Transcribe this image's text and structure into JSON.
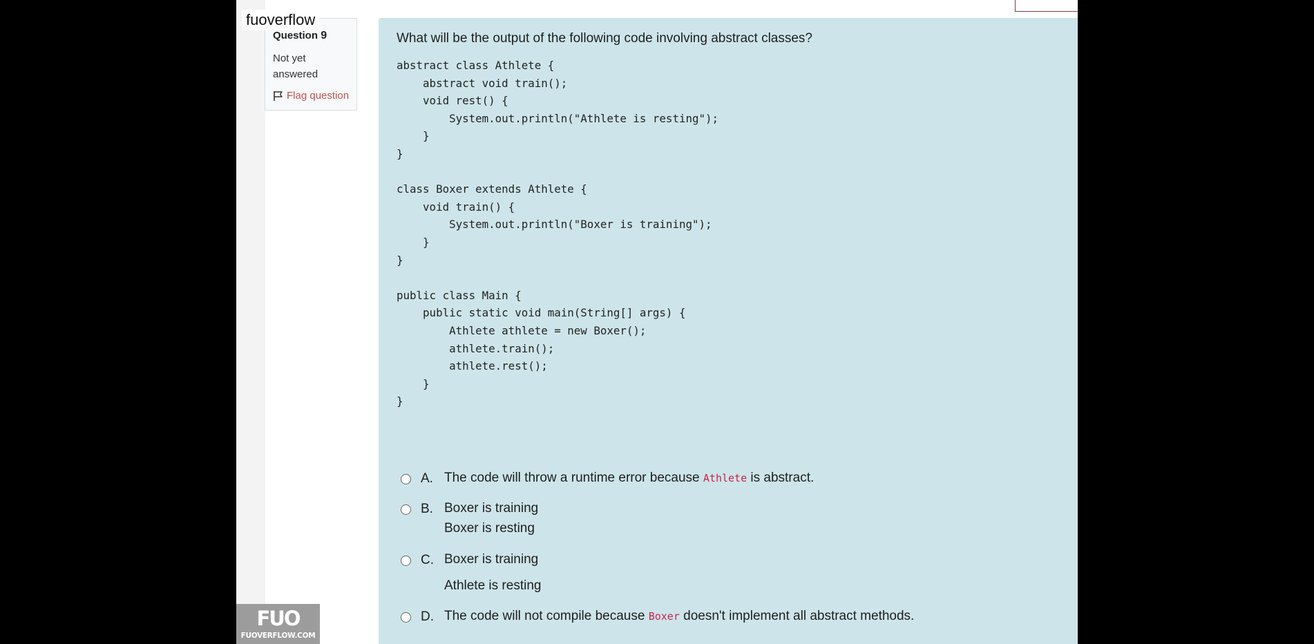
{
  "site": {
    "name": "fuoverflow"
  },
  "question_info": {
    "label": "Question",
    "number": "9",
    "state": "Not yet answered",
    "flag_label": "Flag question"
  },
  "question": {
    "text": "What will be the output of the following code involving abstract classes?",
    "code": "abstract class Athlete {\n    abstract void train();\n    void rest() {\n        System.out.println(\"Athlete is resting\");\n    }\n}\n\nclass Boxer extends Athlete {\n    void train() {\n        System.out.println(\"Boxer is training\");\n    }\n}\n\npublic class Main {\n    public static void main(String[] args) {\n        Athlete athlete = new Boxer();\n        athlete.train();\n        athlete.rest();\n    }\n}"
  },
  "options": [
    {
      "letter": "A.",
      "before": "The code will throw a runtime error because ",
      "code": "Athlete",
      "after": " is abstract."
    },
    {
      "letter": "B.",
      "line1": "Boxer is training",
      "line2": "Boxer is resting"
    },
    {
      "letter": "C.",
      "line1": "Boxer is training",
      "line2": "Athlete is resting"
    },
    {
      "letter": "D.",
      "before": "The code will not compile because ",
      "code": "Boxer",
      "after": " doesn't implement all abstract methods."
    }
  ],
  "watermark": {
    "mark": "FUO",
    "url": "FUOVERFLOW.COM"
  },
  "colors": {
    "question_bg": "#cde5ea",
    "flag": "#c0504d",
    "inline_code": "#c7254e"
  }
}
